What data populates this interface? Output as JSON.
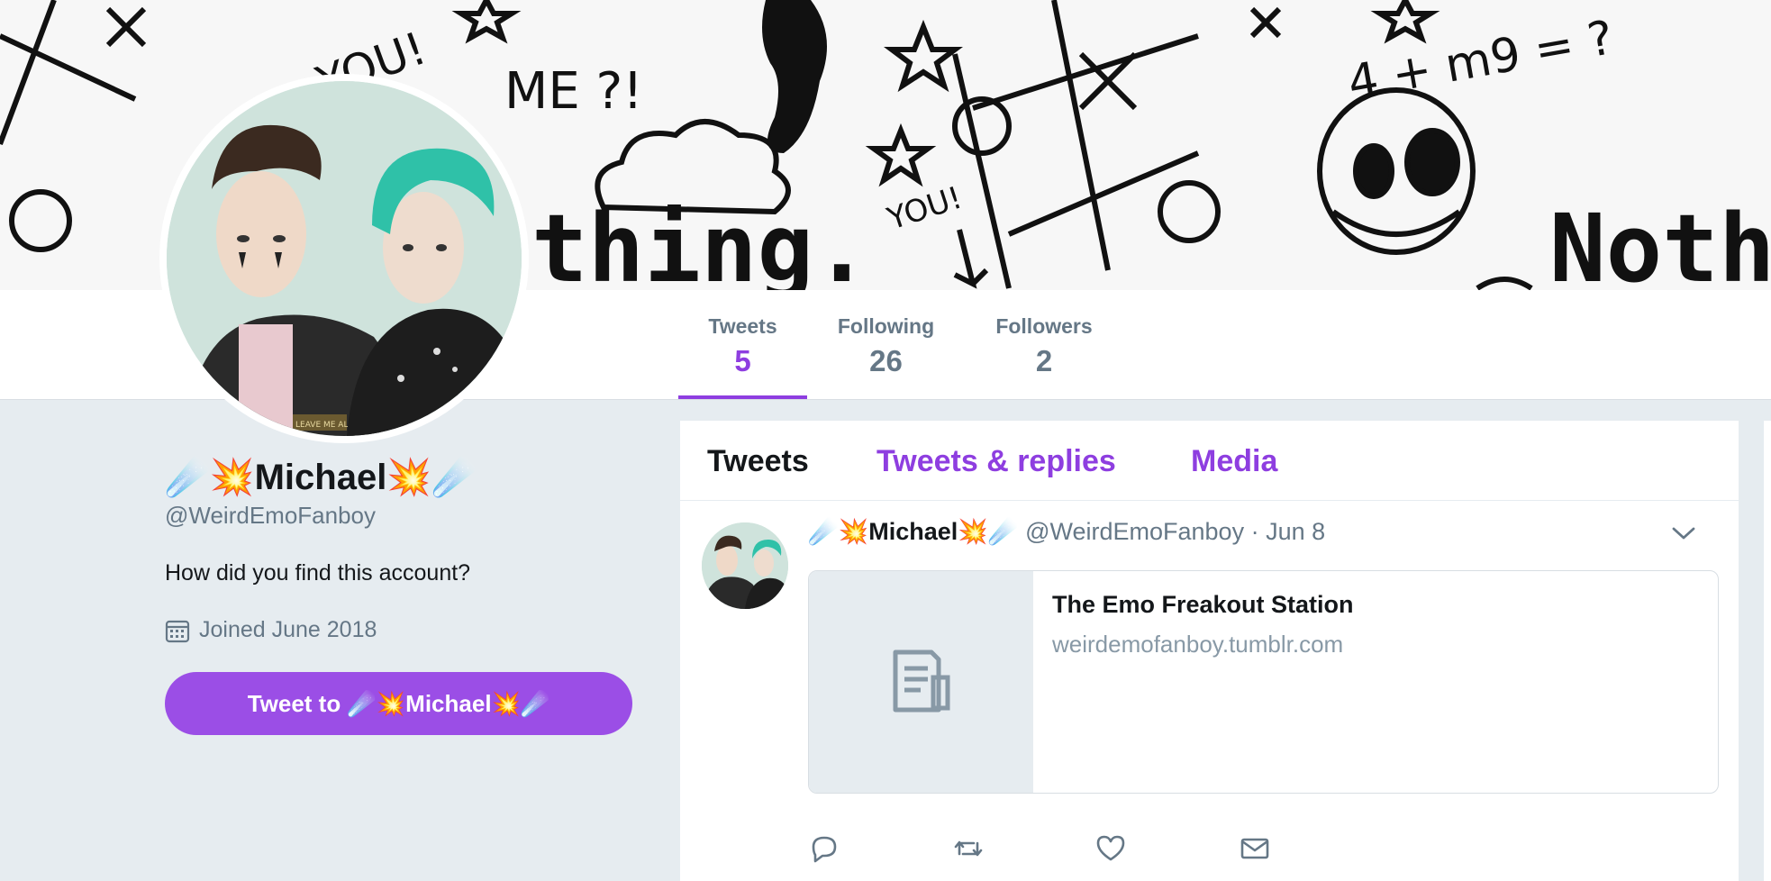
{
  "banner": {
    "doodles": [
      "YOU!",
      "ME ?!",
      "4 + m9 = ?",
      "thing.",
      "Noth",
      "YOU!"
    ]
  },
  "nav": {
    "stats": [
      {
        "label": "Tweets",
        "value": "5"
      },
      {
        "label": "Following",
        "value": "26"
      },
      {
        "label": "Followers",
        "value": "2"
      }
    ]
  },
  "profile": {
    "name_prefix": "☄️💥",
    "name": "Michael",
    "name_suffix": "💥☄️",
    "handle": "@WeirdEmoFanboy",
    "bio": "How did you find this account?",
    "joined": "Joined June 2018",
    "tweet_to_label": "Tweet to ☄️💥Michael💥☄️",
    "jacket_patch": "LEAVE ME ALONE"
  },
  "timeline": {
    "tabs": [
      "Tweets",
      "Tweets & replies",
      "Media"
    ],
    "tweet": {
      "name_prefix": "☄️💥",
      "name": "Michael",
      "name_suffix": "💥☄️",
      "handle": "@WeirdEmoFanboy",
      "separator": "·",
      "date": "Jun 8",
      "card_title": "The Emo Freakout Station",
      "card_url": "weirdemofanboy.tumblr.com"
    }
  },
  "colors": {
    "accent": "#8e3ee0",
    "button": "#9b4ee6",
    "muted": "#657786",
    "background": "#e6ecf0"
  },
  "icons": [
    "calendar-icon",
    "chevron-down-icon",
    "reply-icon",
    "retweet-icon",
    "like-icon",
    "message-icon",
    "document-icon"
  ]
}
